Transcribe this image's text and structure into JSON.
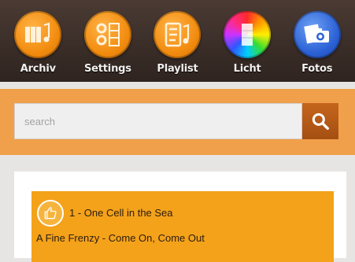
{
  "nav": {
    "items": [
      {
        "label": "Archiv",
        "icon": "archive-icon"
      },
      {
        "label": "Settings",
        "icon": "settings-icon"
      },
      {
        "label": "Playlist",
        "icon": "playlist-icon"
      },
      {
        "label": "Licht",
        "icon": "light-icon"
      },
      {
        "label": "Fotos",
        "icon": "camera-icon"
      }
    ]
  },
  "search": {
    "placeholder": "search",
    "value": "",
    "button_icon": "search-icon"
  },
  "track": {
    "title": "1 - One Cell in the Sea",
    "artist": "A Fine Frenzy - Come On, Come Out",
    "like_icon": "thumbs-up-icon"
  },
  "colors": {
    "topbar": "#3a2c27",
    "accent_orange": "#f0a04a",
    "track_bg": "#f4a21a",
    "search_button": "#b85a17"
  }
}
